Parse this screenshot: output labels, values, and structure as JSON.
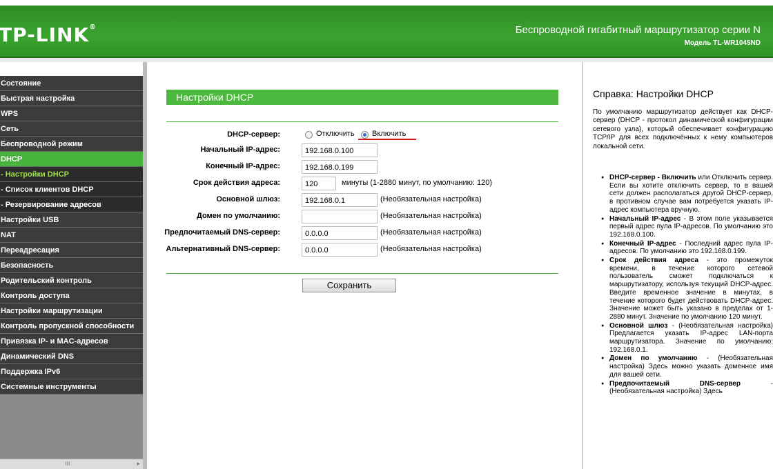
{
  "header": {
    "logo": "TP-LINK",
    "logo_mark": "®",
    "router_title": "Беспроводной гигабитный маршрутизатор серии N",
    "model": "Модель TL-WR1045ND"
  },
  "sidebar": {
    "items": [
      {
        "label": "Состояние",
        "type": "item"
      },
      {
        "label": "Быстрая настройка",
        "type": "item"
      },
      {
        "label": "WPS",
        "type": "item"
      },
      {
        "label": "Сеть",
        "type": "item"
      },
      {
        "label": "Беспроводной режим",
        "type": "item"
      },
      {
        "label": "DHCP",
        "type": "active"
      },
      {
        "label": "- Настройки DHCP",
        "type": "sub-current"
      },
      {
        "label": "- Список клиентов DHCP",
        "type": "sub"
      },
      {
        "label": "- Резервирование адресов",
        "type": "sub"
      },
      {
        "label": "Настройки USB",
        "type": "item"
      },
      {
        "label": "NAT",
        "type": "item"
      },
      {
        "label": "Переадресация",
        "type": "item"
      },
      {
        "label": "Безопасность",
        "type": "item"
      },
      {
        "label": "Родительский контроль",
        "type": "item"
      },
      {
        "label": "Контроль доступа",
        "type": "item"
      },
      {
        "label": "Настройки маршрутизации",
        "type": "item"
      },
      {
        "label": "Контроль пропускной способности",
        "type": "item"
      },
      {
        "label": "Привязка IP- и MAC-адресов",
        "type": "item"
      },
      {
        "label": "Динамический DNS",
        "type": "item"
      },
      {
        "label": "Поддержка IPv6",
        "type": "item"
      },
      {
        "label": "Системные инструменты",
        "type": "item"
      }
    ],
    "scroll_thumb": "III",
    "scroll_arrow": "▸"
  },
  "form": {
    "title": "Настройки DHCP",
    "dhcp_server": {
      "label": "DHCP-сервер:",
      "option_off": "Отключить",
      "option_on": "Включить",
      "selected": "on"
    },
    "start_ip": {
      "label": "Начальный IP-адрес:",
      "value": "192.168.0.100"
    },
    "end_ip": {
      "label": "Конечный IP-адрес:",
      "value": "192.168.0.199"
    },
    "lease": {
      "label": "Срок действия адреса:",
      "value": "120",
      "note": "минуты (1-2880 минут, по умолчанию: 120)"
    },
    "gateway": {
      "label": "Основной шлюз:",
      "value": "192.168.0.1",
      "note": "(Необязательная настройка)"
    },
    "domain": {
      "label": "Домен по умолчанию:",
      "value": "",
      "note": "(Необязательная настройка)"
    },
    "dns_primary": {
      "label": "Предпочитаемый DNS-сервер:",
      "value": "0.0.0.0",
      "note": "(Необязательная настройка)"
    },
    "dns_alt": {
      "label": "Альтернативный DNS-сервер:",
      "value": "0.0.0.0",
      "note": "(Необязательная настройка)"
    },
    "save_label": "Сохранить"
  },
  "help": {
    "title": "Справка: Настройки DHCP",
    "intro": "По умолчанию маршрутизатор действует как DHCP-сервер (DHCP - протокол динамической конфигурации сетевого узла), который обеспечивает конфигурацию TCP/IP для всех подключённых к нему компьютеров локальной сети.",
    "items": [
      {
        "term": "DHCP-сервер - Включить",
        "text": " или Отключить сервер. Если вы хотите отключить сервер, то в вашей сети должен располагаться другой DHCP-сервер, в противном случае вам потребуется указать IP-адрес компьютера вручную."
      },
      {
        "term": "Начальный IP-адрес",
        "text": " - В этом поле указывается первый адрес пула IP-адресов. По умолчанию это 192.168.0.100."
      },
      {
        "term": "Конечный IP-адрес",
        "text": " - Последний адрес пула IP-адресов. По умолчанию это 192.168.0.199."
      },
      {
        "term": "Срок действия адреса",
        "text": " - это промежуток времени, в течение которого сетевой пользователь сможет подключаться к маршрутизатору, используя текущий DHCP-адрес. Введите временное значение в минутах, в течение которого будет действовать DHCP-адрес. Значение может быть указано в пределах от 1-2880 минут. Значение по умолчанию 120 минут."
      },
      {
        "term": "Основной шлюз",
        "text": " - (Необязательная настройка) Предлагается указать IP-адрес LAN-порта маршрутизатора. Значение по умолчанию: 192.168.0.1."
      },
      {
        "term": "Домен по умолчанию",
        "text": " - (Необязательная настройка) Здесь можно указать доменное имя для вашей сети."
      },
      {
        "term": "Предпочитаемый DNS-сервер",
        "text": " - (Необязательная настройка) Здесь"
      }
    ]
  }
}
